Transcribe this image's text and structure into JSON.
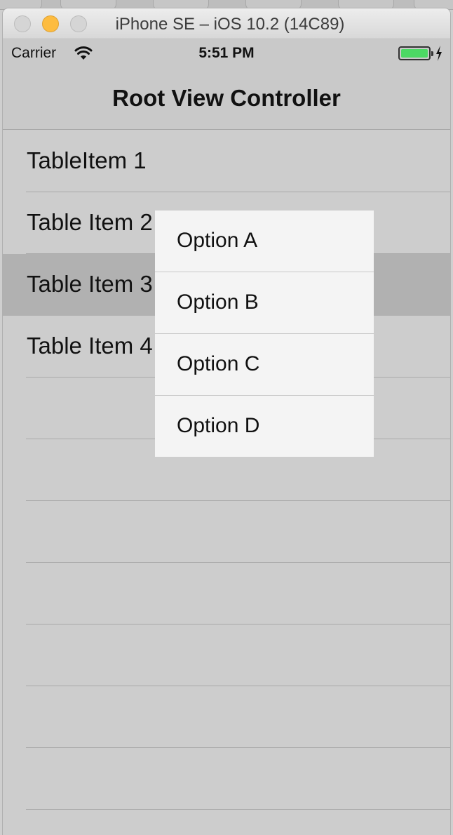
{
  "window": {
    "title": "iPhone SE – iOS 10.2 (14C89)"
  },
  "status_bar": {
    "carrier": "Carrier",
    "time": "5:51 PM",
    "battery_color": "#4cd964"
  },
  "nav_bar": {
    "title": "Root View Controller"
  },
  "table": {
    "rows": [
      {
        "label": "TableItem 1"
      },
      {
        "label": "Table Item 2"
      },
      {
        "label": "Table Item 3"
      },
      {
        "label": "Table Item 4"
      },
      {
        "label": ""
      },
      {
        "label": ""
      },
      {
        "label": ""
      },
      {
        "label": ""
      },
      {
        "label": ""
      },
      {
        "label": ""
      },
      {
        "label": ""
      }
    ],
    "selected_row": 3
  },
  "popup_menu": {
    "options": [
      {
        "label": "Option A"
      },
      {
        "label": "Option B"
      },
      {
        "label": "Option C"
      },
      {
        "label": "Option D"
      }
    ]
  }
}
